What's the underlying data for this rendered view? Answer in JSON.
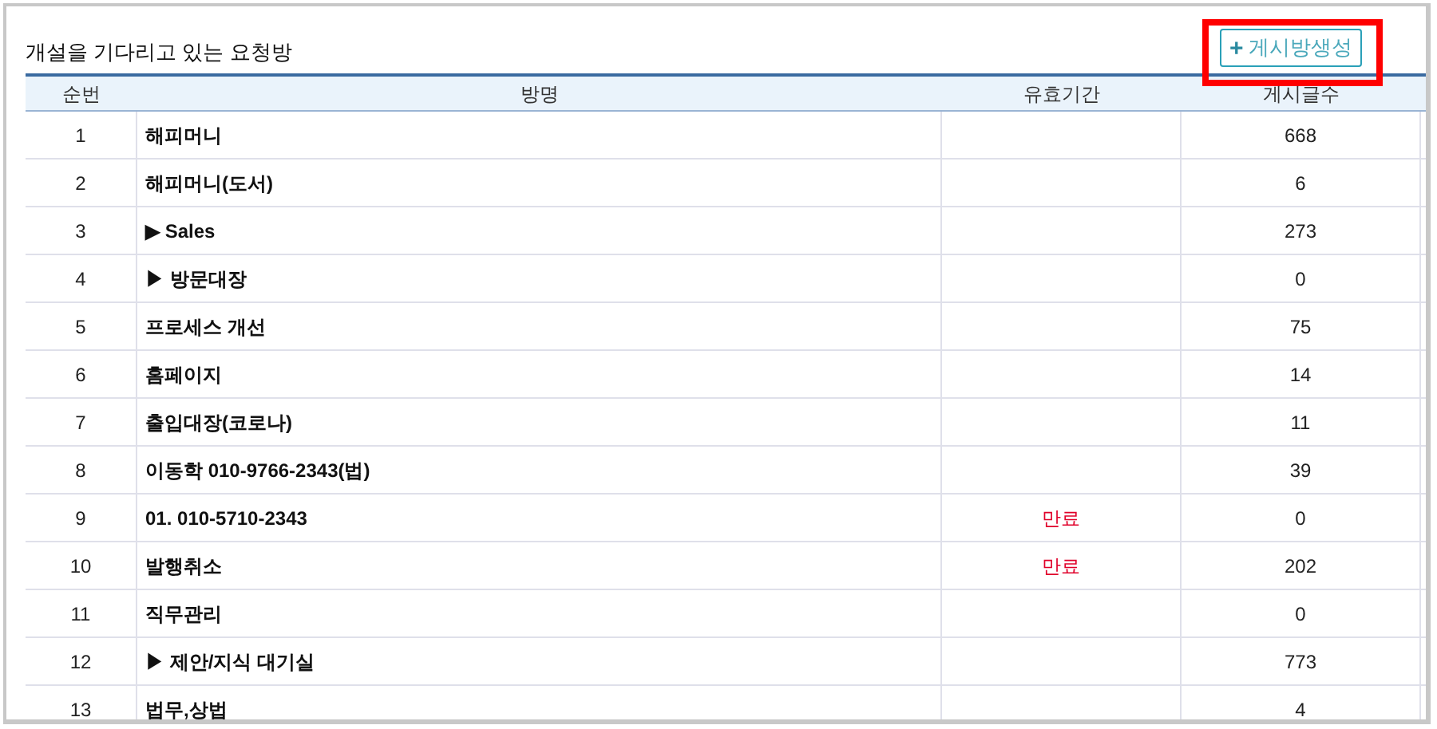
{
  "title": "개설을 기다리고 있는 요청방",
  "create_button": {
    "icon": "+",
    "label": "게시방생성"
  },
  "table": {
    "columns": [
      "순번",
      "방명",
      "유효기간",
      "게시글수"
    ],
    "rows": [
      {
        "no": "1",
        "name": "해피머니",
        "validity": "",
        "posts": "668"
      },
      {
        "no": "2",
        "name": "해피머니(도서)",
        "validity": "",
        "posts": "6"
      },
      {
        "no": "3",
        "name": "▶ Sales",
        "validity": "",
        "posts": "273"
      },
      {
        "no": "4",
        "name": "▶ 방문대장",
        "validity": "",
        "posts": "0"
      },
      {
        "no": "5",
        "name": "프로세스 개선",
        "validity": "",
        "posts": "75"
      },
      {
        "no": "6",
        "name": "홈페이지",
        "validity": "",
        "posts": "14"
      },
      {
        "no": "7",
        "name": "출입대장(코로나)",
        "validity": "",
        "posts": "11"
      },
      {
        "no": "8",
        "name": "이동학 010-9766-2343(법)",
        "validity": "",
        "posts": "39"
      },
      {
        "no": "9",
        "name": "01. 010-5710-2343",
        "validity": "만료",
        "posts": "0"
      },
      {
        "no": "10",
        "name": "발행취소",
        "validity": "만료",
        "posts": "202"
      },
      {
        "no": "11",
        "name": "직무관리",
        "validity": "",
        "posts": "0"
      },
      {
        "no": "12",
        "name": "▶ 제안/지식 대기실",
        "validity": "",
        "posts": "773"
      },
      {
        "no": "13",
        "name": "법무,상법",
        "validity": "",
        "posts": "4"
      }
    ]
  }
}
